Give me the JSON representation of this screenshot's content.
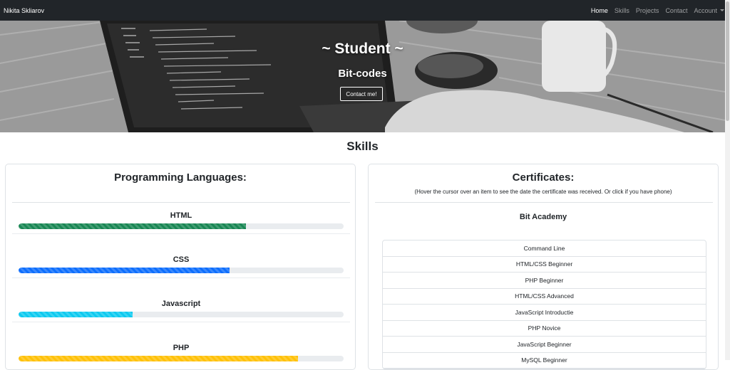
{
  "navbar": {
    "brand": "Nikita Skliarov",
    "links": [
      {
        "label": "Home",
        "active": true
      },
      {
        "label": "Skills",
        "active": false
      },
      {
        "label": "Projects",
        "active": false
      },
      {
        "label": "Contact",
        "active": false
      },
      {
        "label": "Account",
        "active": false
      }
    ]
  },
  "hero": {
    "title": "~ Student ~",
    "subtitle": "Bit-codes",
    "button_label": "Contact me!"
  },
  "skills_heading": "Skills",
  "languages": {
    "title": "Programming Languages:",
    "items": [
      {
        "label": "HTML",
        "percent": 70,
        "color": "#198754"
      },
      {
        "label": "CSS",
        "percent": 65,
        "color": "#0d6efd"
      },
      {
        "label": "Javascript",
        "percent": 35,
        "color": "#0dcaf0"
      },
      {
        "label": "PHP",
        "percent": 86,
        "color": "#ffc107"
      }
    ]
  },
  "certificates": {
    "title": "Certificates:",
    "hint": "(Hover the cursor over an item to see the date the certificate was received. Or click if you have phone)",
    "organization": "Bit Academy",
    "items": [
      "Command Line",
      "HTML/CSS Beginner",
      "PHP Beginner",
      "HTML/CSS Advanced",
      "JavaScript Introductie",
      "PHP Novice",
      "JavaScript Beginner",
      "MySQL Beginner"
    ]
  }
}
